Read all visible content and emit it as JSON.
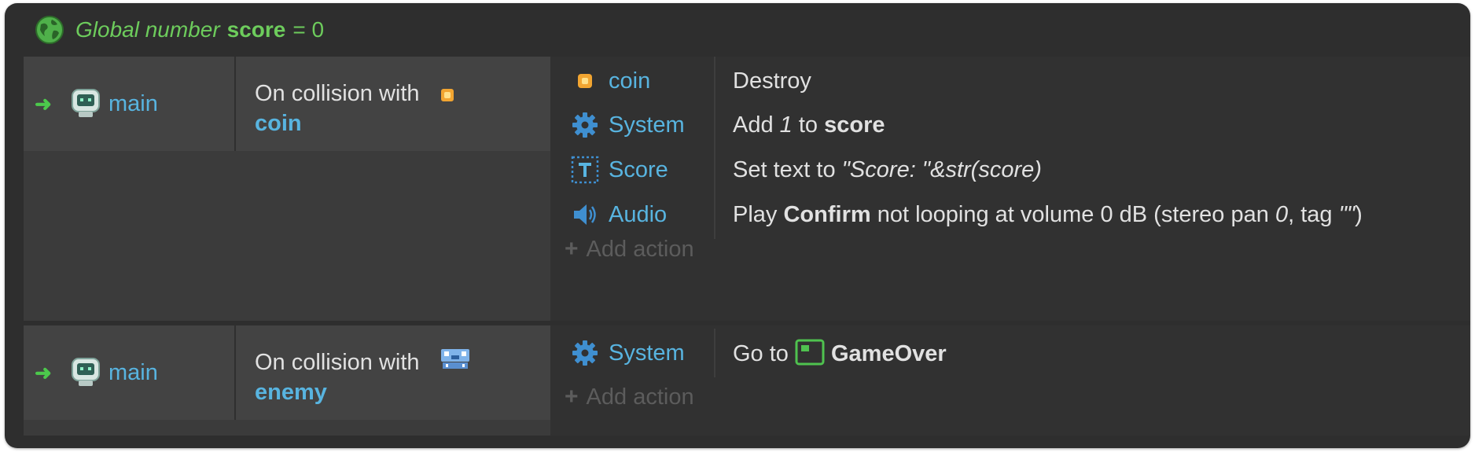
{
  "global_var": {
    "keyword": "Global number",
    "name": "score",
    "equals": "= 0"
  },
  "events": [
    {
      "condition": {
        "object": "main",
        "text": "On collision with",
        "param": "coin"
      },
      "actions": [
        {
          "object": "coin",
          "icon": "coin-icon",
          "text_parts": [
            "Destroy"
          ]
        },
        {
          "object": "System",
          "icon": "gear-icon",
          "pre": "Add ",
          "num": "1",
          "mid": " to ",
          "bold": "score"
        },
        {
          "object": "Score",
          "icon": "text-object-icon",
          "pre": "Set text to ",
          "italic": "\"Score: \"&str(score)"
        },
        {
          "object": "Audio",
          "icon": "speaker-icon",
          "pre": "Play ",
          "bold": "Confirm",
          "mid": " not looping at volume 0 dB (stereo pan ",
          "num": "0",
          "post": ", tag ",
          "tag": "\"\"",
          "end": ")"
        }
      ],
      "add_action": "Add action"
    },
    {
      "condition": {
        "object": "main",
        "text": "On collision with",
        "param": "enemy"
      },
      "actions": [
        {
          "object": "System",
          "icon": "gear-icon",
          "pre": "Go to ",
          "bold": "GameOver"
        }
      ],
      "add_action": "Add action"
    }
  ],
  "colors": {
    "accent_blue": "#58b4e0",
    "global_green": "#6dcc5c",
    "arrow_green": "#4cc94c",
    "background": "#2e2e2e"
  }
}
